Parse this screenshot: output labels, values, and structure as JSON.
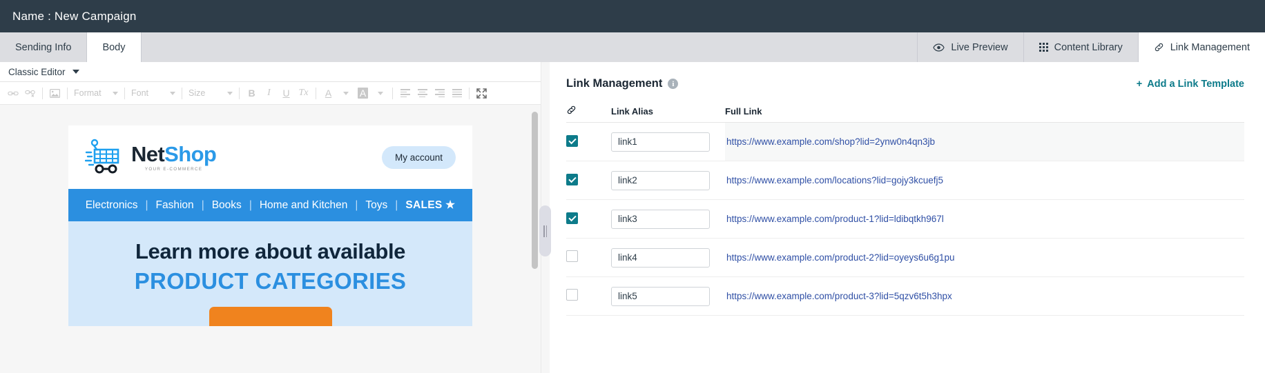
{
  "titlebar": {
    "title": "Name : New Campaign"
  },
  "tabs": {
    "left": [
      {
        "label": "Sending Info",
        "active": false
      },
      {
        "label": "Body",
        "active": true
      }
    ],
    "right": [
      {
        "label": "Live Preview",
        "icon": "eye-icon",
        "active": false
      },
      {
        "label": "Content Library",
        "icon": "grid-icon",
        "active": false
      },
      {
        "label": "Link Management",
        "icon": "link-icon",
        "active": true
      }
    ]
  },
  "editor": {
    "mode_label": "Classic Editor",
    "toolbar": {
      "format_label": "Format",
      "font_label": "Font",
      "size_label": "Size",
      "bold_label": "B",
      "italic_label": "I",
      "underline_label": "U",
      "remove_format_label": "Tx",
      "text_color_label": "A",
      "bg_color_label": "A"
    }
  },
  "email": {
    "brand": {
      "name_part1": "Net",
      "name_part2": "Shop",
      "tagline": "YOUR E-COMMERCE"
    },
    "account_button": "My account",
    "nav": [
      "Electronics",
      "Fashion",
      "Books",
      "Home and Kitchen",
      "Toys"
    ],
    "nav_sale": "SALES",
    "nav_sale_star": "★",
    "nav_separator": "|",
    "hero_line1": "Learn more about available",
    "hero_line2": "PRODUCT CATEGORIES"
  },
  "link_management": {
    "panel_title": "Link Management",
    "info_glyph": "i",
    "add_template_plus": "+",
    "add_template_label": "Add a Link Template",
    "columns": {
      "checkbox_icon": "link-icon",
      "alias": "Link Alias",
      "full_link": "Full Link"
    },
    "rows": [
      {
        "checked": true,
        "alias": "link1",
        "full_link": "https://www.example.com/shop?lid=2ynw0n4qn3jb",
        "highlight": true
      },
      {
        "checked": true,
        "alias": "link2",
        "full_link": "https://www.example.com/locations?lid=gojy3kcuefj5",
        "highlight": false
      },
      {
        "checked": true,
        "alias": "link3",
        "full_link": "https://www.example.com/product-1?lid=ldibqtkh967l",
        "highlight": false
      },
      {
        "checked": false,
        "alias": "link4",
        "full_link": "https://www.example.com/product-2?lid=oyeys6u6g1pu",
        "highlight": false
      },
      {
        "checked": false,
        "alias": "link5",
        "full_link": "https://www.example.com/product-3?lid=5qzv6t5h3hpx",
        "highlight": false
      }
    ]
  },
  "colors": {
    "titlebar_bg": "#2e3d49",
    "tabstrip_bg": "#dcdde1",
    "accent_teal": "#0d7b8a",
    "link_blue": "#2f4fa5",
    "brand_blue": "#2b9ae8",
    "nav_blue": "#2b8fe0",
    "hero_bg": "#d4e8fa",
    "cta_orange": "#f0831e"
  }
}
